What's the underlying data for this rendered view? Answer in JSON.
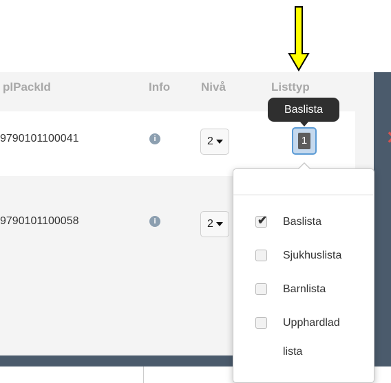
{
  "table": {
    "columns": [
      "plPackId",
      "Info",
      "Nivå",
      "Listtyp"
    ],
    "rows": [
      {
        "pack_id": "9790101100041",
        "level": "2"
      },
      {
        "pack_id": "9790101100058",
        "level": "2"
      }
    ]
  },
  "info_icon_glyph": "i",
  "badge": {
    "value": "1"
  },
  "tooltip": {
    "text": "Baslista"
  },
  "listtyp_options": [
    {
      "label": "Baslista",
      "checked": true
    },
    {
      "label": "Sjukhuslista",
      "checked": false
    },
    {
      "label": "Barnlista",
      "checked": false
    },
    {
      "label_line1": "Upphardlad",
      "label_line2": "lista",
      "checked": false
    }
  ],
  "colors": {
    "arrow": "#ffff00",
    "header_text": "#a8a8a8",
    "dark_bar": "#4b5b6c",
    "focus": "#5b9bd5"
  }
}
